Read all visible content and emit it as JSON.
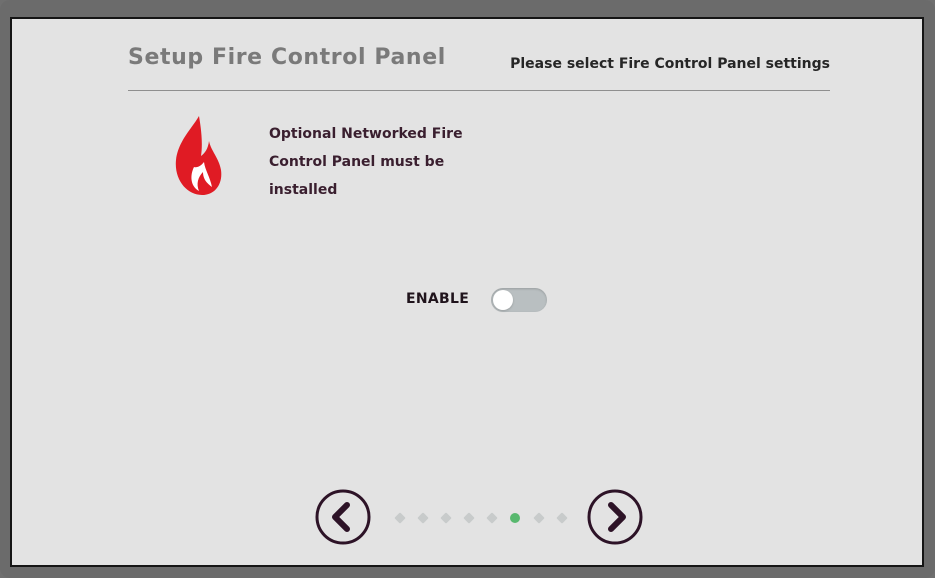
{
  "header": {
    "title": "Setup Fire Control Panel",
    "subtitle": "Please select Fire Control Panel settings"
  },
  "notice": {
    "icon": "flame-icon",
    "lines": [
      "Optional Networked Fire",
      "Control Panel must be",
      "installed"
    ]
  },
  "toggle": {
    "label": "ENABLE",
    "enabled": false
  },
  "navigation": {
    "previous_icon": "chevron-left-icon",
    "next_icon": "chevron-right-icon",
    "page_count": 8,
    "current_page": 6
  },
  "colors": {
    "screen_background": "#e3e3e3",
    "frame": "#6b6b6b",
    "flame_red": "#e01b24",
    "active_page": "#58b86e",
    "inactive_page": "#c8cbcb",
    "dark_text": "#3a1f2f"
  }
}
